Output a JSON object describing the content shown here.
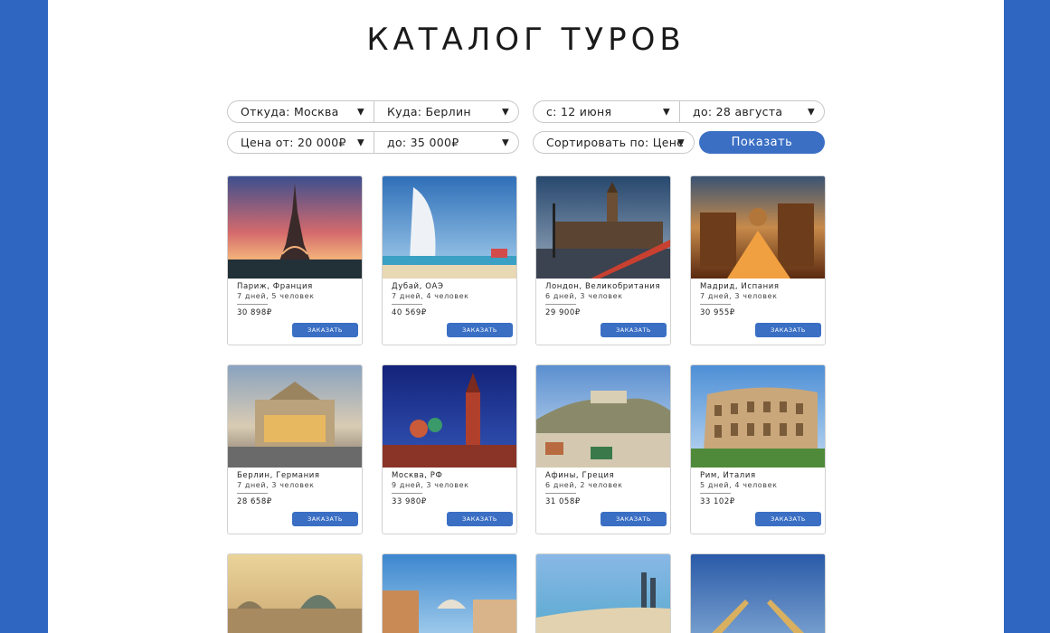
{
  "title": "КАТАЛОГ ТУРОВ",
  "filters": {
    "from": "Откуда: Москва",
    "to": "Куда: Берлин",
    "date_from": "с: 12 июня",
    "date_to": "до: 28 августа",
    "price_from": "Цена от: 20 000₽",
    "price_to": "до: 35 000₽",
    "sort": "Сортировать по: Цене",
    "dropdown_arrow": "▼",
    "show_button": "Показать"
  },
  "order_label": "ЗАКАЗАТЬ",
  "tours": [
    {
      "place": "Париж, Франция",
      "meta": "7 дней, 5 человек",
      "price": "30 898₽"
    },
    {
      "place": "Дубай, ОАЭ",
      "meta": "7 дней, 4 человек",
      "price": "40 569₽"
    },
    {
      "place": "Лондон, Великобритания",
      "meta": "6 дней, 3 человек",
      "price": "29 900₽"
    },
    {
      "place": "Мадрид, Испания",
      "meta": "7 дней, 3 человек",
      "price": "30 955₽"
    },
    {
      "place": "Берлин, Германия",
      "meta": "7 дней, 3 человек",
      "price": "28 658₽"
    },
    {
      "place": "Москва, РФ",
      "meta": "9 дней, 3 человек",
      "price": "33 980₽"
    },
    {
      "place": "Афины, Греция",
      "meta": "6 дней, 2 человек",
      "price": "31 058₽"
    },
    {
      "place": "Рим, Италия",
      "meta": "5 дней, 4 человек",
      "price": "33 102₽"
    }
  ],
  "colors": {
    "background": "#2f66c1",
    "accent": "#3a6fc4"
  }
}
